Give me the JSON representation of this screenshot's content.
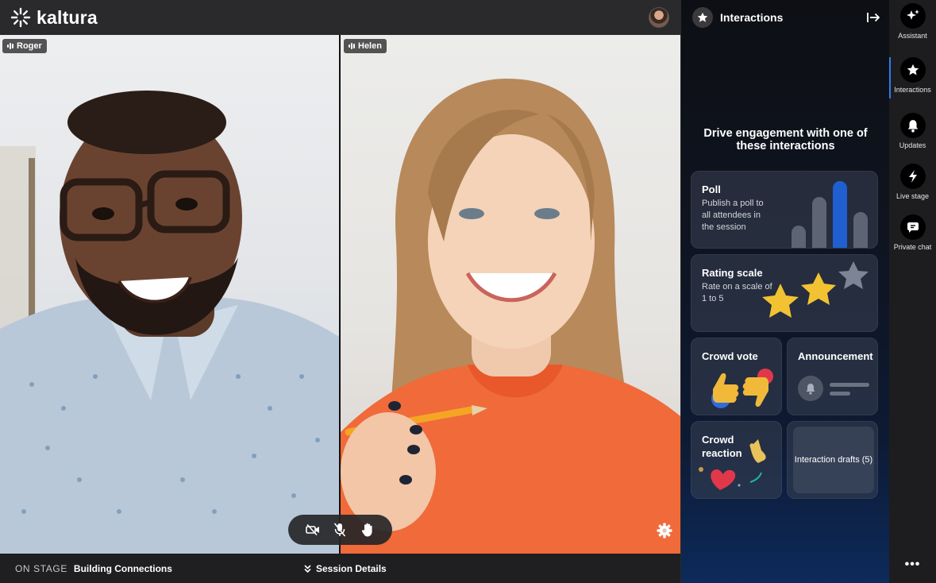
{
  "app": {
    "brand": "kaltura"
  },
  "stage": {
    "participants": [
      {
        "name": "Roger"
      },
      {
        "name": "Helen"
      }
    ],
    "controls": [
      "camera-off-icon",
      "mic-off-icon",
      "raise-hand-icon"
    ]
  },
  "bottombar": {
    "on_stage_label": "ON STAGE",
    "session_title": "Building Connections",
    "session_details_label": "Session Details"
  },
  "panel": {
    "title": "Interactions",
    "heading": "Drive engagement with one of these interactions",
    "cards": {
      "poll": {
        "title": "Poll",
        "desc": "Publish a poll to all attendees in the session"
      },
      "rating": {
        "title": "Rating scale",
        "desc": "Rate on a scale of 1 to 5"
      },
      "crowdvote": {
        "title": "Crowd vote"
      },
      "announce": {
        "title": "Announcement"
      },
      "reaction": {
        "title": "Crowd reaction"
      },
      "drafts": {
        "title": "Interaction drafts (5)"
      }
    }
  },
  "rail": {
    "items": [
      {
        "label": "Assistant",
        "icon": "sparkle-icon"
      },
      {
        "label": "Interactions",
        "icon": "star-icon"
      },
      {
        "label": "Updates",
        "icon": "bell-icon"
      },
      {
        "label": "Live stage",
        "icon": "bolt-icon"
      },
      {
        "label": "Private chat",
        "icon": "chat-icon"
      }
    ],
    "more_label": "•••"
  },
  "colors": {
    "accent": "#2e7bf0",
    "poll_highlight_bar": "#1f5fd0",
    "star": "#f2c233"
  }
}
